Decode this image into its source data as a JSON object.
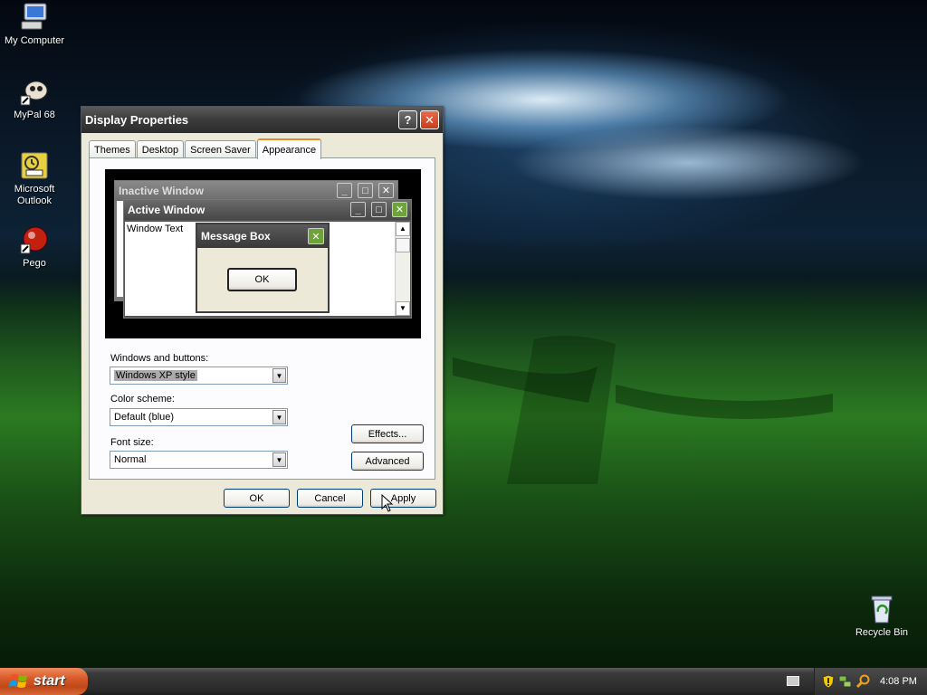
{
  "desktop": {
    "icons": [
      {
        "label": "My Computer",
        "icon": "my-computer-icon"
      },
      {
        "label": "MyPal 68",
        "icon": "mypal-icon"
      },
      {
        "label_line1": "Microsoft",
        "label_line2": "Outlook",
        "icon": "outlook-icon"
      },
      {
        "label": "Pego",
        "icon": "pego-icon"
      },
      {
        "label": "Recycle Bin",
        "icon": "recycle-bin-icon"
      }
    ]
  },
  "dialog": {
    "title": "Display Properties",
    "help_glyph": "?",
    "close_glyph": "✕",
    "tabs": [
      "Themes",
      "Desktop",
      "Screen Saver",
      "Appearance"
    ],
    "active_tab": "Appearance",
    "preview": {
      "inactive_title": "Inactive Window",
      "active_title": "Active Window",
      "window_text": "Window Text",
      "message_title": "Message Box",
      "message_ok": "OK"
    },
    "windows_buttons": {
      "label": "Windows and buttons:",
      "value": "Windows XP style"
    },
    "color_scheme": {
      "label": "Color scheme:",
      "value": "Default (blue)"
    },
    "font_size": {
      "label": "Font size:",
      "value": "Normal"
    },
    "effects_label": "Effects...",
    "advanced_label": "Advanced",
    "ok_label": "OK",
    "cancel_label": "Cancel",
    "apply_label": "Apply"
  },
  "taskbar": {
    "start_label": "start",
    "clock": "4:08 PM"
  },
  "colors": {
    "titlebar": "#3b3b3b",
    "close_button": "#c63d1f",
    "start_button": "#d65a2a",
    "active_tab_accent": "#e68b2c",
    "mini_active_close": "#6ca33a"
  }
}
